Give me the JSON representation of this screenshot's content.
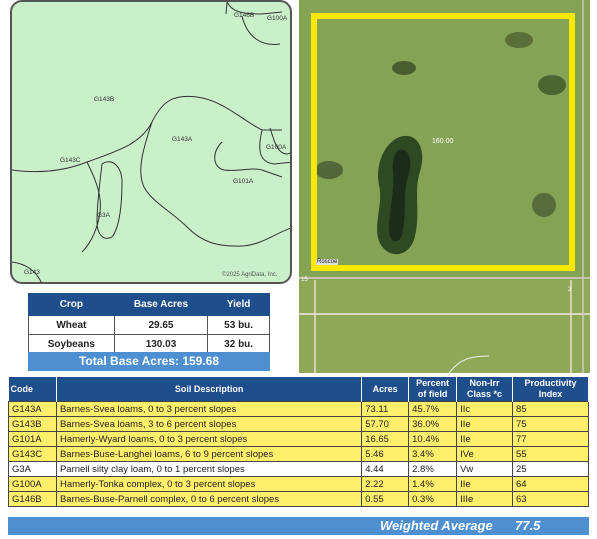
{
  "soil_map": {
    "labels": [
      "G146B",
      "G100A",
      "G143B",
      "G143A",
      "G143C",
      "G100A",
      "G101A",
      "G3A",
      "G143"
    ],
    "copyright": "©2025 AgriData, Inc."
  },
  "aerial": {
    "field_label": "160.00",
    "road_label": "Roscoe",
    "left_marker": "15",
    "right_marker": "2"
  },
  "crop_table": {
    "headers": [
      "Crop",
      "Base Acres",
      "Yield"
    ],
    "rows": [
      [
        "Wheat",
        "29.65",
        "53 bu."
      ],
      [
        "Soybeans",
        "130.03",
        "32 bu."
      ]
    ],
    "total_label": "Total Base Acres:  159.68"
  },
  "soil_table": {
    "headers": [
      "Code",
      "Soil Description",
      "Acres",
      "Percent of field",
      "Non-Irr Class *c",
      "Productivity Index"
    ],
    "rows": [
      {
        "code": "G143A",
        "desc": "Barnes-Svea loams, 0 to 3 percent slopes",
        "acres": "73.11",
        "pct": "45.7%",
        "cls": "IIc",
        "pi": "85",
        "hl": true
      },
      {
        "code": "G143B",
        "desc": "Barnes-Svea loams, 3 to 6 percent slopes",
        "acres": "57.70",
        "pct": "36.0%",
        "cls": "IIe",
        "pi": "75",
        "hl": true
      },
      {
        "code": "G101A",
        "desc": "Hamerly-Wyard loams, 0 to 3 percent slopes",
        "acres": "16.65",
        "pct": "10.4%",
        "cls": "IIe",
        "pi": "77",
        "hl": true
      },
      {
        "code": "G143C",
        "desc": "Barnes-Buse-Langhei loams, 6 to 9 percent slopes",
        "acres": "5.46",
        "pct": "3.4%",
        "cls": "IVe",
        "pi": "55",
        "hl": true
      },
      {
        "code": "G3A",
        "desc": "Parnell silty clay loam, 0 to 1 percent slopes",
        "acres": "4.44",
        "pct": "2.8%",
        "cls": "Vw",
        "pi": "25",
        "hl": false
      },
      {
        "code": "G100A",
        "desc": "Hamerly-Tonka complex, 0 to 3 percent slopes",
        "acres": "2.22",
        "pct": "1.4%",
        "cls": "IIe",
        "pi": "64",
        "hl": true
      },
      {
        "code": "G146B",
        "desc": "Barnes-Buse-Parnell complex, 0 to 6 percent slopes",
        "acres": "0.55",
        "pct": "0.3%",
        "cls": "IIIe",
        "pi": "63",
        "hl": true
      }
    ],
    "weighted_label": "Weighted Average",
    "weighted_value": "77.5"
  },
  "colors": {
    "header_blue": "#1f4e8c",
    "total_blue": "#4d8fd1",
    "highlight": "#ffef6b",
    "map_green": "#c9f0c9",
    "field_outline": "#ffe800"
  }
}
